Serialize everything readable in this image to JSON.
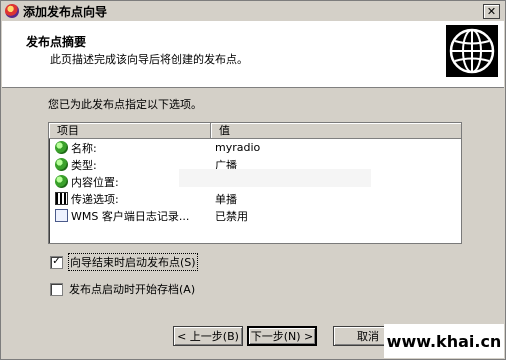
{
  "window": {
    "title": "添加发布点向导",
    "close_glyph": "✕"
  },
  "header": {
    "title": "发布点摘要",
    "subtitle": "此页描述完成该向导后将创建的发布点。"
  },
  "intro_text": "您已为此发布点指定以下选项。",
  "list": {
    "columns": [
      "项目",
      "值"
    ],
    "rows": [
      {
        "name": "名称:",
        "value": "myradio",
        "icon": "green-globe-icon"
      },
      {
        "name": "类型:",
        "value": "广播",
        "icon": "green-globe-icon"
      },
      {
        "name": "内容位置:",
        "value": "",
        "icon": "green-globe-icon"
      },
      {
        "name": "传递选项:",
        "value": "单播",
        "icon": "film-strip-icon"
      },
      {
        "name": "WMS 客户端日志记录...",
        "value": "已禁用",
        "icon": "log-document-icon"
      }
    ]
  },
  "options": {
    "start_on_finish": {
      "label": "向导结束时启动发布点",
      "hotkey": "(S)",
      "checked": true,
      "mark": "✓"
    },
    "archive_on_start": {
      "label": "发布点启动时开始存档",
      "hotkey": "(A)",
      "checked": false,
      "mark": ""
    }
  },
  "buttons": {
    "back": "< 上一步(B)",
    "next": "下一步(N) >",
    "cancel": "取消"
  },
  "watermark": "www.khai.cn"
}
